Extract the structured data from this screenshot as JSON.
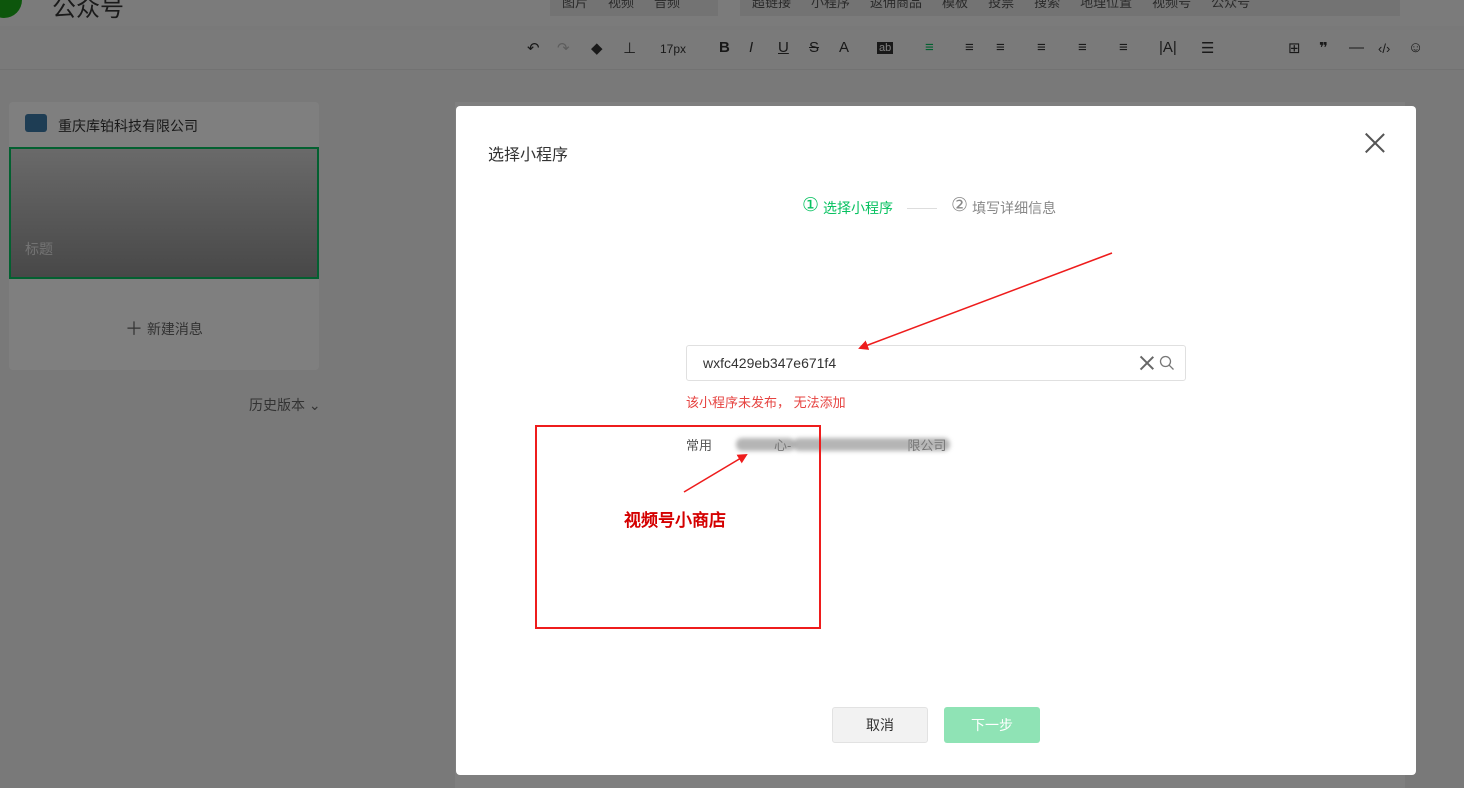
{
  "app": {
    "logo_text": "公众号",
    "insert_menu_left": [
      "图片",
      "视频",
      "音频"
    ],
    "insert_menu_right": [
      "超链接",
      "小程序",
      "返佣商品",
      "模板",
      "投票",
      "搜索",
      "地理位置",
      "视频号",
      "公众号"
    ],
    "toolbar": {
      "font_size": "17px"
    }
  },
  "left_panel": {
    "company_name": "重庆库铂科技有限公司",
    "article_title_placeholder": "标题",
    "new_message_label": "新建消息",
    "history_label": "历史版本"
  },
  "modal": {
    "title": "选择小程序",
    "steps": [
      {
        "num": "①",
        "label": "选择小程序",
        "active": true
      },
      {
        "num": "②",
        "label": "填写详细信息",
        "active": false
      }
    ],
    "search": {
      "value": "wxfc429eb347e671f4",
      "placeholder": ""
    },
    "error_message": "该小程序未发布， 无法添加",
    "common": {
      "label": "常用",
      "items": [
        "心-",
        "限公司"
      ]
    },
    "cancel_label": "取消",
    "next_label": "下一步"
  },
  "annotation": {
    "label": "视频号小商店",
    "color": "#ee1c1c"
  },
  "colors": {
    "accent": "#07c160",
    "error": "#e64340",
    "next_disabled": "#8fe3b5"
  }
}
